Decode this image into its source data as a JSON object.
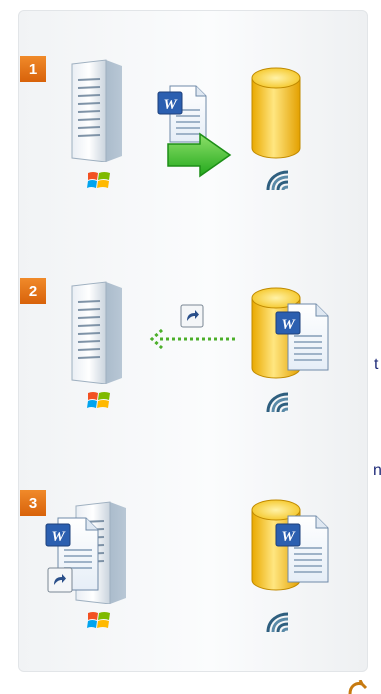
{
  "steps": [
    {
      "badge": "1"
    },
    {
      "badge": "2"
    },
    {
      "badge": "3"
    }
  ],
  "side_text": [
    "t",
    "n"
  ],
  "icons": {
    "server": "server-icon",
    "database": "database-icon",
    "document": "word-document-icon",
    "windows": "windows-logo-icon",
    "sharepoint": "sharepoint-logo-icon",
    "shortcut": "shortcut-arrow-icon",
    "move_arrow": "green-arrow-icon"
  },
  "colors": {
    "badge": "#e8781a",
    "database": "#f2c21a",
    "arrow": "#3cba2e",
    "text": "#1e2a78"
  }
}
